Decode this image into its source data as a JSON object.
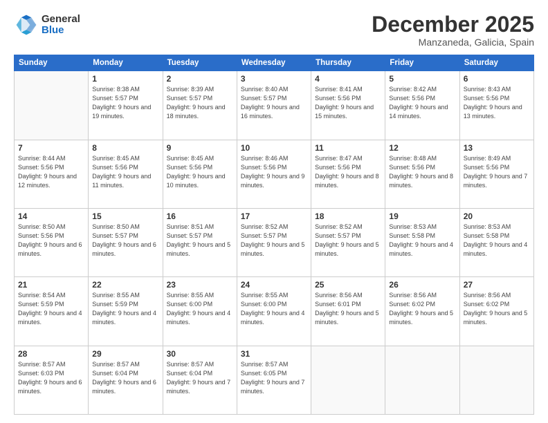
{
  "logo": {
    "general": "General",
    "blue": "Blue"
  },
  "header": {
    "month_year": "December 2025",
    "location": "Manzaneda, Galicia, Spain"
  },
  "weekdays": [
    "Sunday",
    "Monday",
    "Tuesday",
    "Wednesday",
    "Thursday",
    "Friday",
    "Saturday"
  ],
  "weeks": [
    [
      {
        "day": "",
        "sunrise": "",
        "sunset": "",
        "daylight": ""
      },
      {
        "day": "1",
        "sunrise": "Sunrise: 8:38 AM",
        "sunset": "Sunset: 5:57 PM",
        "daylight": "Daylight: 9 hours and 19 minutes."
      },
      {
        "day": "2",
        "sunrise": "Sunrise: 8:39 AM",
        "sunset": "Sunset: 5:57 PM",
        "daylight": "Daylight: 9 hours and 18 minutes."
      },
      {
        "day": "3",
        "sunrise": "Sunrise: 8:40 AM",
        "sunset": "Sunset: 5:57 PM",
        "daylight": "Daylight: 9 hours and 16 minutes."
      },
      {
        "day": "4",
        "sunrise": "Sunrise: 8:41 AM",
        "sunset": "Sunset: 5:56 PM",
        "daylight": "Daylight: 9 hours and 15 minutes."
      },
      {
        "day": "5",
        "sunrise": "Sunrise: 8:42 AM",
        "sunset": "Sunset: 5:56 PM",
        "daylight": "Daylight: 9 hours and 14 minutes."
      },
      {
        "day": "6",
        "sunrise": "Sunrise: 8:43 AM",
        "sunset": "Sunset: 5:56 PM",
        "daylight": "Daylight: 9 hours and 13 minutes."
      }
    ],
    [
      {
        "day": "7",
        "sunrise": "Sunrise: 8:44 AM",
        "sunset": "Sunset: 5:56 PM",
        "daylight": "Daylight: 9 hours and 12 minutes."
      },
      {
        "day": "8",
        "sunrise": "Sunrise: 8:45 AM",
        "sunset": "Sunset: 5:56 PM",
        "daylight": "Daylight: 9 hours and 11 minutes."
      },
      {
        "day": "9",
        "sunrise": "Sunrise: 8:45 AM",
        "sunset": "Sunset: 5:56 PM",
        "daylight": "Daylight: 9 hours and 10 minutes."
      },
      {
        "day": "10",
        "sunrise": "Sunrise: 8:46 AM",
        "sunset": "Sunset: 5:56 PM",
        "daylight": "Daylight: 9 hours and 9 minutes."
      },
      {
        "day": "11",
        "sunrise": "Sunrise: 8:47 AM",
        "sunset": "Sunset: 5:56 PM",
        "daylight": "Daylight: 9 hours and 8 minutes."
      },
      {
        "day": "12",
        "sunrise": "Sunrise: 8:48 AM",
        "sunset": "Sunset: 5:56 PM",
        "daylight": "Daylight: 9 hours and 8 minutes."
      },
      {
        "day": "13",
        "sunrise": "Sunrise: 8:49 AM",
        "sunset": "Sunset: 5:56 PM",
        "daylight": "Daylight: 9 hours and 7 minutes."
      }
    ],
    [
      {
        "day": "14",
        "sunrise": "Sunrise: 8:50 AM",
        "sunset": "Sunset: 5:56 PM",
        "daylight": "Daylight: 9 hours and 6 minutes."
      },
      {
        "day": "15",
        "sunrise": "Sunrise: 8:50 AM",
        "sunset": "Sunset: 5:57 PM",
        "daylight": "Daylight: 9 hours and 6 minutes."
      },
      {
        "day": "16",
        "sunrise": "Sunrise: 8:51 AM",
        "sunset": "Sunset: 5:57 PM",
        "daylight": "Daylight: 9 hours and 5 minutes."
      },
      {
        "day": "17",
        "sunrise": "Sunrise: 8:52 AM",
        "sunset": "Sunset: 5:57 PM",
        "daylight": "Daylight: 9 hours and 5 minutes."
      },
      {
        "day": "18",
        "sunrise": "Sunrise: 8:52 AM",
        "sunset": "Sunset: 5:57 PM",
        "daylight": "Daylight: 9 hours and 5 minutes."
      },
      {
        "day": "19",
        "sunrise": "Sunrise: 8:53 AM",
        "sunset": "Sunset: 5:58 PM",
        "daylight": "Daylight: 9 hours and 4 minutes."
      },
      {
        "day": "20",
        "sunrise": "Sunrise: 8:53 AM",
        "sunset": "Sunset: 5:58 PM",
        "daylight": "Daylight: 9 hours and 4 minutes."
      }
    ],
    [
      {
        "day": "21",
        "sunrise": "Sunrise: 8:54 AM",
        "sunset": "Sunset: 5:59 PM",
        "daylight": "Daylight: 9 hours and 4 minutes."
      },
      {
        "day": "22",
        "sunrise": "Sunrise: 8:55 AM",
        "sunset": "Sunset: 5:59 PM",
        "daylight": "Daylight: 9 hours and 4 minutes."
      },
      {
        "day": "23",
        "sunrise": "Sunrise: 8:55 AM",
        "sunset": "Sunset: 6:00 PM",
        "daylight": "Daylight: 9 hours and 4 minutes."
      },
      {
        "day": "24",
        "sunrise": "Sunrise: 8:55 AM",
        "sunset": "Sunset: 6:00 PM",
        "daylight": "Daylight: 9 hours and 4 minutes."
      },
      {
        "day": "25",
        "sunrise": "Sunrise: 8:56 AM",
        "sunset": "Sunset: 6:01 PM",
        "daylight": "Daylight: 9 hours and 5 minutes."
      },
      {
        "day": "26",
        "sunrise": "Sunrise: 8:56 AM",
        "sunset": "Sunset: 6:02 PM",
        "daylight": "Daylight: 9 hours and 5 minutes."
      },
      {
        "day": "27",
        "sunrise": "Sunrise: 8:56 AM",
        "sunset": "Sunset: 6:02 PM",
        "daylight": "Daylight: 9 hours and 5 minutes."
      }
    ],
    [
      {
        "day": "28",
        "sunrise": "Sunrise: 8:57 AM",
        "sunset": "Sunset: 6:03 PM",
        "daylight": "Daylight: 9 hours and 6 minutes."
      },
      {
        "day": "29",
        "sunrise": "Sunrise: 8:57 AM",
        "sunset": "Sunset: 6:04 PM",
        "daylight": "Daylight: 9 hours and 6 minutes."
      },
      {
        "day": "30",
        "sunrise": "Sunrise: 8:57 AM",
        "sunset": "Sunset: 6:04 PM",
        "daylight": "Daylight: 9 hours and 7 minutes."
      },
      {
        "day": "31",
        "sunrise": "Sunrise: 8:57 AM",
        "sunset": "Sunset: 6:05 PM",
        "daylight": "Daylight: 9 hours and 7 minutes."
      },
      {
        "day": "",
        "sunrise": "",
        "sunset": "",
        "daylight": ""
      },
      {
        "day": "",
        "sunrise": "",
        "sunset": "",
        "daylight": ""
      },
      {
        "day": "",
        "sunrise": "",
        "sunset": "",
        "daylight": ""
      }
    ]
  ]
}
